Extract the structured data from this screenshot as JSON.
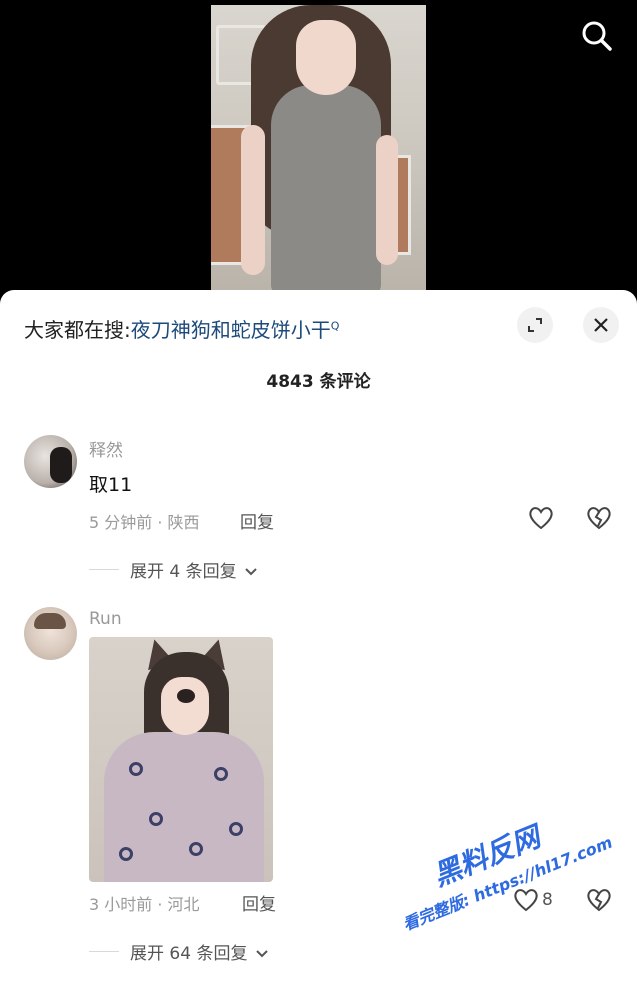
{
  "trending": {
    "prefix": "大家都在搜:",
    "keyword": "夜刀神狗和蛇皮饼小干",
    "search_glyph": "Q"
  },
  "comments_count_label": "4843 条评论",
  "comments": [
    {
      "username": "释然",
      "text": "取11",
      "meta": "5 分钟前 · 陕西",
      "reply_label": "回复",
      "expand_label": "展开 4 条回复",
      "like_count": ""
    },
    {
      "username": "Run",
      "text": "",
      "meta": "3 小时前 · 河北",
      "reply_label": "回复",
      "expand_label": "展开 64 条回复",
      "like_count": "8"
    }
  ],
  "watermark": {
    "line1": "黑料反网",
    "line2": "看完整版: https://hl17.com"
  },
  "icons": {
    "search": "search-icon",
    "expand": "expand-icon",
    "close": "close-icon",
    "like": "heart-icon",
    "dislike": "broken-heart-icon",
    "chevron": "chevron-down-icon"
  },
  "colors": {
    "keyword": "#1d4a7a",
    "meta": "#9a9a9a",
    "sheet_bg": "#ffffff",
    "top_bg": "#000000"
  }
}
